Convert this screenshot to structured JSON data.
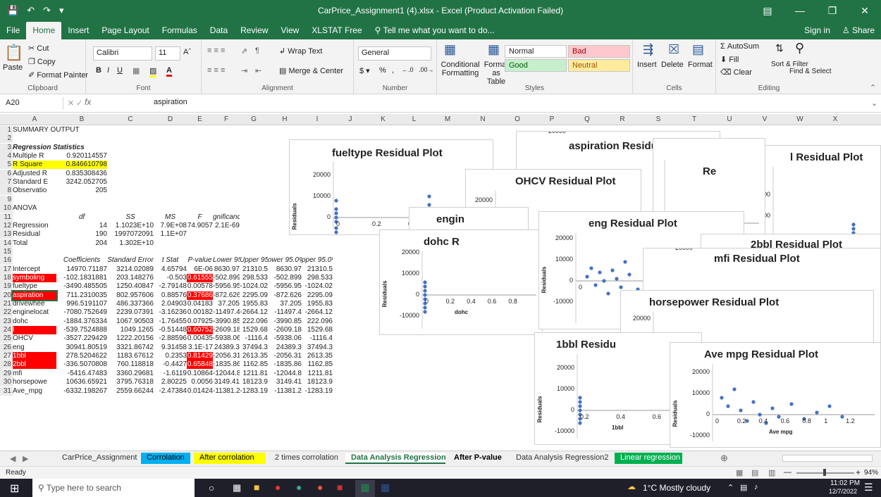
{
  "title": "CarPrice_Assignment1 (4).xlsx - Excel (Product Activation Failed)",
  "menu": [
    "File",
    "Home",
    "Insert",
    "Page Layout",
    "Formulas",
    "Data",
    "Review",
    "View",
    "XLSTAT Free"
  ],
  "tellme": "Tell me what you want to do...",
  "signin": "Sign in",
  "share": "Share",
  "ribbon": {
    "clipboard": {
      "paste": "Paste",
      "cut": "Cut",
      "copy": "Copy",
      "painter": "Format Painter",
      "label": "Clipboard"
    },
    "font": {
      "name": "Calibri",
      "size": "11",
      "label": "Font"
    },
    "alignment": {
      "wrap": "Wrap Text",
      "merge": "Merge & Center",
      "label": "Alignment"
    },
    "number": {
      "format": "General",
      "label": "Number"
    },
    "styles": {
      "cond": "Conditional Formatting",
      "table": "Format as Table",
      "normal": "Normal",
      "bad": "Bad",
      "good": "Good",
      "neutral": "Neutral",
      "label": "Styles"
    },
    "cells": {
      "insert": "Insert",
      "delete": "Delete",
      "format": "Format",
      "label": "Cells"
    },
    "editing": {
      "autosum": "AutoSum",
      "fill": "Fill",
      "clear": "Clear",
      "sort": "Sort & Filter",
      "find": "Find & Select",
      "label": "Editing"
    }
  },
  "formula_bar": {
    "name_box": "A20",
    "fx": "fx",
    "value": "aspiration"
  },
  "columns": [
    "A",
    "B",
    "C",
    "D",
    "E",
    "F",
    "G",
    "H",
    "I",
    "J",
    "K",
    "L",
    "M",
    "N",
    "O",
    "P",
    "Q",
    "R",
    "S",
    "T",
    "U",
    "V",
    "W",
    "X"
  ],
  "rows": [
    [
      "SUMMARY OUTPUT",
      "",
      "",
      "",
      "",
      "",
      "",
      "",
      ""
    ],
    [
      "",
      "",
      "",
      "",
      "",
      "",
      "",
      "",
      ""
    ],
    [
      "Regression Statistics",
      "",
      "",
      "",
      "",
      "",
      "",
      "",
      ""
    ],
    [
      "Multiple R",
      "0.920114557",
      "",
      "",
      "",
      "",
      "",
      "",
      ""
    ],
    [
      "R Square",
      "0.846610798",
      "",
      "",
      "",
      "",
      "",
      "",
      ""
    ],
    [
      "Adjusted R",
      "0.835308436",
      "",
      "",
      "",
      "",
      "",
      "",
      ""
    ],
    [
      "Standard E",
      "3242.052705",
      "",
      "",
      "",
      "",
      "",
      "",
      ""
    ],
    [
      "Observatio",
      "205",
      "",
      "",
      "",
      "",
      "",
      "",
      ""
    ],
    [
      "",
      "",
      "",
      "",
      "",
      "",
      "",
      "",
      ""
    ],
    [
      "ANOVA",
      "",
      "",
      "",
      "",
      "",
      "",
      "",
      ""
    ],
    [
      "",
      "df",
      "SS",
      "MS",
      "F",
      "gnificance F",
      "",
      "",
      ""
    ],
    [
      "Regression",
      "14",
      "1.1023E+10",
      "7.9E+08",
      "74.9057",
      "2.1E-69",
      "",
      "",
      ""
    ],
    [
      "Residual",
      "190",
      "1997072091",
      "1.1E+07",
      "",
      "",
      "",
      "",
      ""
    ],
    [
      "Total",
      "204",
      "1.302E+10",
      "",
      "",
      "",
      "",
      "",
      ""
    ],
    [
      "",
      "",
      "",
      "",
      "",
      "",
      "",
      "",
      ""
    ],
    [
      "",
      "Coefficients",
      "Standard Error",
      "t Stat",
      "P-value",
      "Lower 95%",
      "Upper 95%",
      "ower 95.0%",
      "pper 95.0%"
    ],
    [
      "Intercept",
      "14970.71187",
      "3214.02089",
      "4.65794",
      "6E-06",
      "8630.97",
      "21310.5",
      "8630.97",
      "21310.5"
    ],
    [
      "symboling",
      "-102.1831881",
      "203.148276",
      "-0.503",
      "0.61555",
      "-502.899",
      "298.533",
      "-502.899",
      "298.533"
    ],
    [
      "fueltype",
      "-3490.485505",
      "1250.40847",
      "-2.79148",
      "0.00578",
      "-5956.95",
      "-1024.02",
      "-5956.95",
      "-1024.02"
    ],
    [
      "aspiration",
      "711.2310035",
      "802.957606",
      "0.88576",
      "0.37686",
      "-872.626",
      "2295.09",
      "-872.626",
      "2295.09"
    ],
    [
      "drivewhee",
      "996.5191107",
      "486.337366",
      "2.04903",
      "0.04183",
      "37.205",
      "1955.83",
      "37.205",
      "1955.83"
    ],
    [
      "enginelocat",
      "-7080.752649",
      "2239.07391",
      "-3.16236",
      "0.00182",
      "-11497.4",
      "-2664.12",
      "-11497.4",
      "-2664.12"
    ],
    [
      "dohc",
      "-1884.376334",
      "1067.90503",
      "-1.76455",
      "0.07925",
      "-3990.85",
      "222.096",
      "-3990.85",
      "222.096"
    ],
    [
      "l",
      "-539.7524888",
      "1049.1265",
      "-0.51448",
      "0.60752",
      "-2609.18",
      "1529.68",
      "-2609.18",
      "1529.68"
    ],
    [
      "OHCV",
      "-3527.229429",
      "1222.20156",
      "-2.88596",
      "0.00435",
      "-5938.06",
      "-1116.4",
      "-5938.06",
      "-1116.4"
    ],
    [
      "eng",
      "30941.80519",
      "3321.86742",
      "9.31458",
      "3.1E-17",
      "24389.3",
      "37494.3",
      "24389.3",
      "37494.3"
    ],
    [
      "1bbl",
      "278.5204622",
      "1183.67612",
      "0.2353",
      "0.81429",
      "-2056.31",
      "2613.35",
      "-2056.31",
      "2613.35"
    ],
    [
      "2bbl",
      "-336.5070808",
      "760.118818",
      "-0.4427",
      "0.65848",
      "-1835.86",
      "1162.85",
      "-1835.86",
      "1162.85"
    ],
    [
      "mfi",
      "-5416.47483",
      "3360.29681",
      "-1.6119",
      "0.10864",
      "-12044.8",
      "1211.81",
      "-12044.8",
      "1211.81"
    ],
    [
      "horsepowe",
      "10636.65921",
      "3795.76318",
      "2.80225",
      "0.0056",
      "3149.41",
      "18123.9",
      "3149.41",
      "18123.9"
    ],
    [
      "Ave_mpg",
      "-6332.198267",
      "2559.66244",
      "-2.47384",
      "0.01424",
      "-11381.2",
      "-1283.19",
      "-11381.2",
      "-1283.19"
    ]
  ],
  "charts": [
    {
      "title": "fueltype  Residual Plot",
      "ylabel": "Residuals",
      "yticks": [
        "20000",
        "10000",
        "0",
        "-10000"
      ],
      "xticks": [
        "0",
        "0.2",
        "0.4",
        "0"
      ]
    },
    {
      "title": "aspiration  Residual Plot",
      "yticks": [
        "20000"
      ]
    },
    {
      "title": "l  Residual Plot",
      "yticks": [
        "20000",
        "10000"
      ],
      "xticks": [
        "0.4",
        "0.6",
        "0.8",
        "1",
        "1.2"
      ]
    },
    {
      "title": "Re"
    },
    {
      "title": "OHCV  Residual Plot",
      "ylabel": "Residuals",
      "yticks": [
        "20000",
        "10000",
        "0",
        "-10000"
      ],
      "xticks": [
        "0"
      ]
    },
    {
      "title": "engin"
    },
    {
      "title": "dohc  R",
      "ylabel": "Residuals",
      "xlabel": "dohc",
      "yticks": [
        "20000",
        "10000",
        "0",
        "-10000"
      ],
      "xticks": [
        "0",
        "0.2",
        "0.4",
        "0.6",
        "0.8"
      ]
    },
    {
      "title": "eng   Residual Plot",
      "ylabel": "Residuals",
      "yticks": [
        "20000",
        "10000",
        "0",
        "-10000"
      ],
      "xticks": [
        "0",
        "1"
      ]
    },
    {
      "title": "2bbl  Residual Plot"
    },
    {
      "title": "mfi  Residual Plot",
      "yticks": [
        "20000"
      ]
    },
    {
      "title": "horsepower  Residual Plot",
      "ylabel": "Residuals",
      "yticks": [
        "20000",
        "10000",
        "0",
        "-10000"
      ],
      "xticks": [
        "1.2"
      ]
    },
    {
      "title": "1bbl  Residu",
      "ylabel": "Residuals",
      "xlabel": "1bbl",
      "yticks": [
        "20000",
        "10000",
        "0",
        "-10000"
      ],
      "xticks": [
        "0.2",
        "0.4",
        "0.6"
      ]
    },
    {
      "title": "Ave  mpg  Residual Plot",
      "ylabel": "Residuals",
      "xlabel": "Ave  mpg",
      "yticks": [
        "20000",
        "10000",
        "0",
        "-10000"
      ],
      "xticks": [
        "0",
        "0.2",
        "0.4",
        "0.6",
        "0.8",
        "1",
        "1.2"
      ]
    }
  ],
  "sheet_tabs": [
    {
      "label": "CarPrice_Assignment",
      "bg": "#f0f0f0",
      "color": "#333"
    },
    {
      "label": "Corrolation",
      "bg": "#00b0f0",
      "color": "#000"
    },
    {
      "label": "After corrolation",
      "bg": "#ffff00",
      "color": "#000"
    },
    {
      "label": "2 times corrolation",
      "bg": "#f0f0f0",
      "color": "#333"
    },
    {
      "label": "Data Analysis Regression",
      "bg": "#ffffff",
      "color": "#217346"
    },
    {
      "label": "After P-value",
      "bg": "#f0f0f0",
      "color": "#000"
    },
    {
      "label": "Data Analysis Regression2",
      "bg": "#f0f0f0",
      "color": "#333"
    },
    {
      "label": "Linear regression",
      "bg": "#00b050",
      "color": "#fff"
    }
  ],
  "status": "Ready",
  "zoom": "94%",
  "taskbar": {
    "search": "Type here to search",
    "weather": "1°C  Mostly cloudy",
    "time": "11:02 PM",
    "date": "12/7/2022"
  }
}
